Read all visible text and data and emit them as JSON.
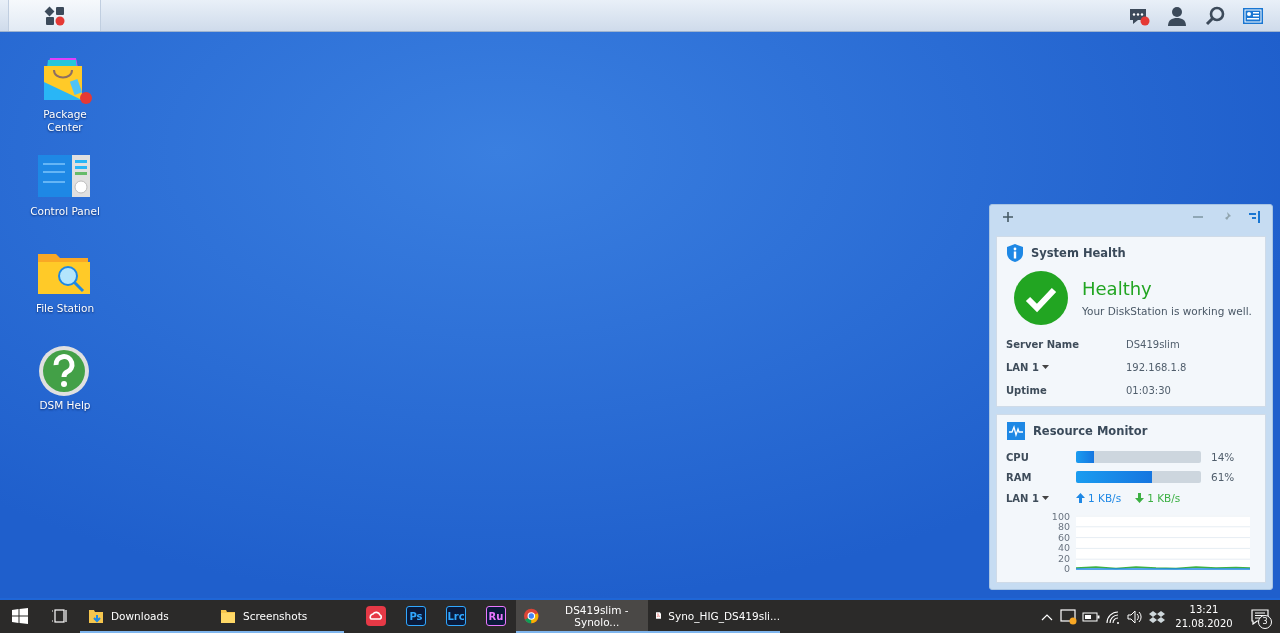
{
  "topbar": {
    "main_menu": {
      "selected": true
    },
    "notification_badge": true
  },
  "desktop_icons": [
    {
      "kind": "package",
      "label": "Package Center",
      "badge": true
    },
    {
      "kind": "control",
      "label": "Control Panel",
      "badge": false
    },
    {
      "kind": "folder",
      "label": "File Station",
      "badge": false
    },
    {
      "kind": "help",
      "label": "DSM Help",
      "badge": false
    }
  ],
  "widget": {
    "panels": [
      {
        "kind": "health",
        "title": "System Health",
        "status": "Healthy",
        "message": "Your DiskStation is working well.",
        "rows": [
          {
            "label": "Server Name",
            "dropdown": false,
            "value": "DS419slim"
          },
          {
            "label": "LAN 1",
            "dropdown": true,
            "value": "192.168.1.8"
          },
          {
            "label": "Uptime",
            "dropdown": false,
            "value": "01:03:30"
          }
        ]
      },
      {
        "kind": "resource",
        "title": "Resource Monitor",
        "meters": [
          {
            "label": "CPU",
            "level": 0.14,
            "reading": "14%"
          },
          {
            "label": "RAM",
            "level": 0.61,
            "reading": "61%"
          }
        ],
        "network": {
          "label": "LAN 1",
          "upload": "1 KB/s",
          "download": "1 KB/s"
        },
        "chart_ticks": [
          "100",
          "80",
          "60",
          "40",
          "20",
          "0"
        ]
      }
    ]
  },
  "taskbar": {
    "items": [
      {
        "kind": "start",
        "open": false,
        "selected": false
      },
      {
        "kind": "taskview",
        "open": false,
        "selected": false
      },
      {
        "kind": "download-folder",
        "label": "Downloads",
        "open": true,
        "selected": false
      },
      {
        "kind": "folder",
        "label": "Screenshots",
        "open": true,
        "selected": false
      },
      {
        "kind": "cloud",
        "open": false,
        "selected": false
      },
      {
        "kind": "app",
        "label": "Ps",
        "color": "#31a8ff",
        "open": false,
        "selected": false
      },
      {
        "kind": "app",
        "label": "Lrc",
        "color": "#31a8ff",
        "open": false,
        "selected": false
      },
      {
        "kind": "app",
        "label": "Ru",
        "color": "#ea77ff",
        "open": false,
        "selected": false
      },
      {
        "kind": "browser",
        "label": "DS419slim - Synolo...",
        "open": true,
        "selected": true
      },
      {
        "kind": "pdf",
        "label": "Syno_HIG_DS419sli...",
        "open": true,
        "selected": false
      }
    ],
    "time": "13:21",
    "date": "21.08.2020",
    "notifications": "3"
  }
}
